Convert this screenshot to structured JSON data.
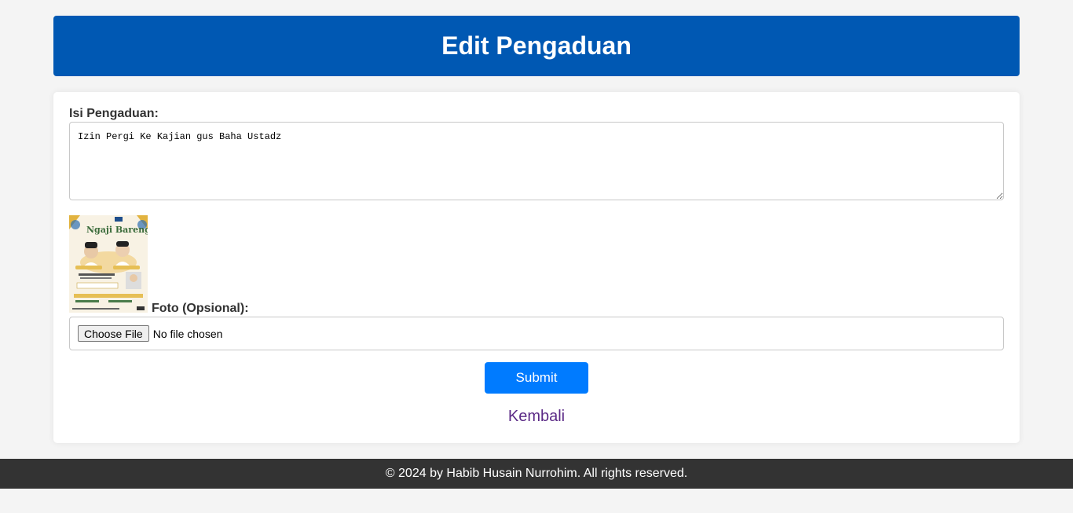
{
  "header": {
    "title": "Edit Pengaduan"
  },
  "form": {
    "isi_label": "Isi Pengaduan:",
    "isi_value": "Izin Pergi Ke Kajian gus Baha Ustadz",
    "foto_label": "Foto (Opsional):",
    "photo_title": "Ngaji Bareng",
    "file_button": "Choose File",
    "file_status": "No file chosen",
    "submit_label": "Submit",
    "back_label": "Kembali"
  },
  "footer": {
    "text": "© 2024 by Habib Husain Nurrohim. All rights reserved."
  },
  "colors": {
    "header_bg": "#0058b3",
    "submit_bg": "#007bff",
    "link": "#5b2a86",
    "footer_bg": "#333333"
  }
}
